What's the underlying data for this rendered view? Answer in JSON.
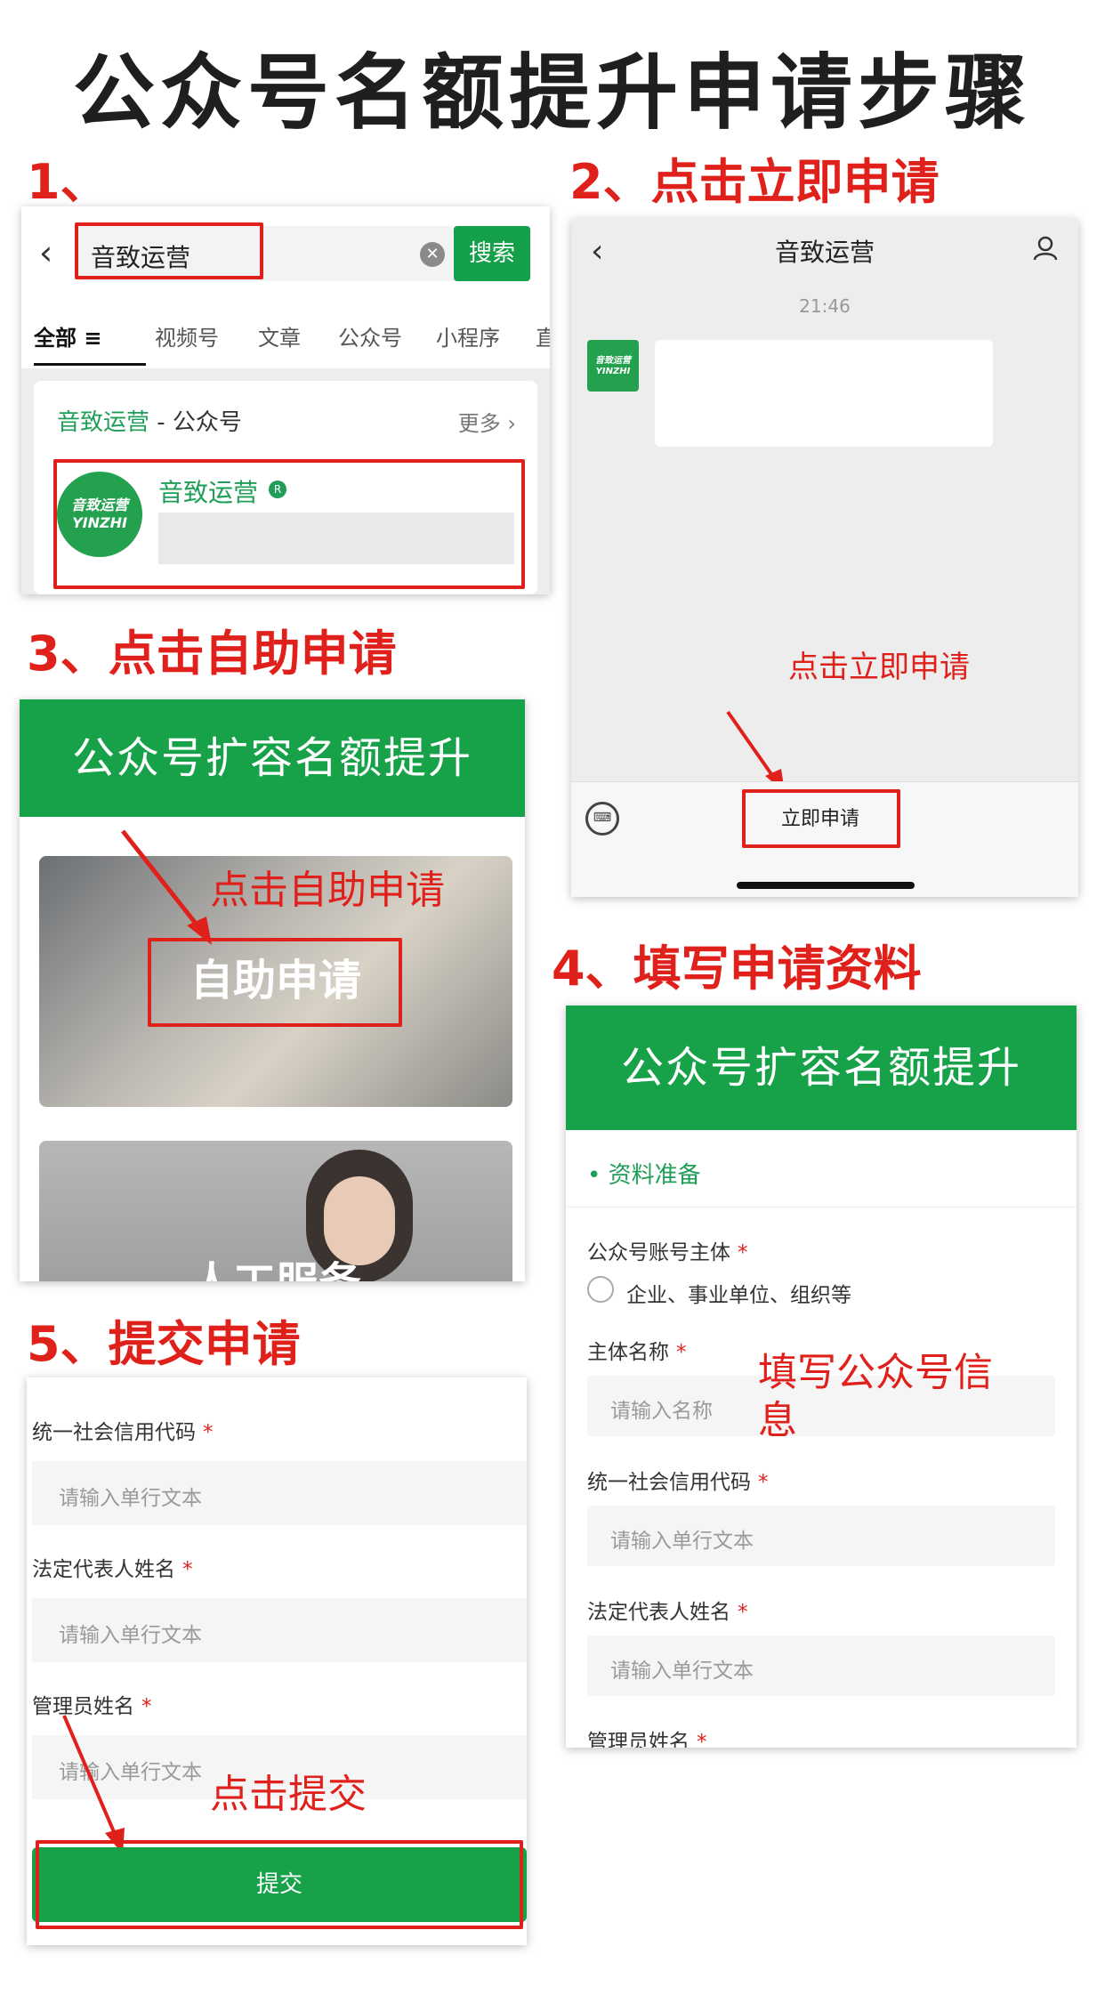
{
  "title": "公众号名额提升申请步骤",
  "steps": {
    "s1": "1、",
    "s2": "2、点击立即申请",
    "s3": "3、点击自助申请",
    "s4": "4、填写申请资料",
    "s5": "5、提交申请"
  },
  "search_panel": {
    "query": "音致运营",
    "search_button": "搜索",
    "tabs": [
      "全部",
      "视频号",
      "文章",
      "公众号",
      "小程序",
      "直"
    ],
    "result_title_name": "音致运营",
    "result_title_suffix": " - 公众号",
    "more": "更多 ›",
    "account_name": "音致运营",
    "avatar_text_1": "音致运营",
    "avatar_text_2": "YINZHI"
  },
  "chat_panel": {
    "title": "音致运营",
    "time": "21:46",
    "avatar_text_1": "音致运营",
    "avatar_text_2": "YINZHI",
    "annotation": "点击立即申请",
    "apply_button": "立即申请"
  },
  "self_apply_panel": {
    "header": "公众号扩容名额提升",
    "annotation": "点击自助申请",
    "card1_label": "自助申请",
    "card2_label": "人工服务"
  },
  "form_panel": {
    "header": "公众号扩容名额提升",
    "section": "• 资料准备",
    "label_subject": "公众号账号主体",
    "radio_option": "企业、事业单位、组织等",
    "label_name": "主体名称",
    "placeholder_name": "请输入名称",
    "label_credit": "统一社会信用代码",
    "placeholder_credit": "请输入单行文本",
    "label_legal": "法定代表人姓名",
    "placeholder_legal": "请输入单行文本",
    "label_admin": "管理员姓名",
    "annotation_line1": "填写公众号信",
    "annotation_line2": "息",
    "required_mark": "*"
  },
  "submit_panel": {
    "label_credit": "统一社会信用代码",
    "placeholder_credit": "请输入单行文本",
    "label_legal": "法定代表人姓名",
    "placeholder_legal": "请输入单行文本",
    "label_admin": "管理员姓名",
    "placeholder_admin": "请输入单行文本",
    "annotation": "点击提交",
    "submit_button": "提交",
    "required_mark": "*"
  },
  "colors": {
    "accent_green": "#17a24a",
    "annotation_red": "#e0211b",
    "title_dark": "#1f1f1f"
  }
}
